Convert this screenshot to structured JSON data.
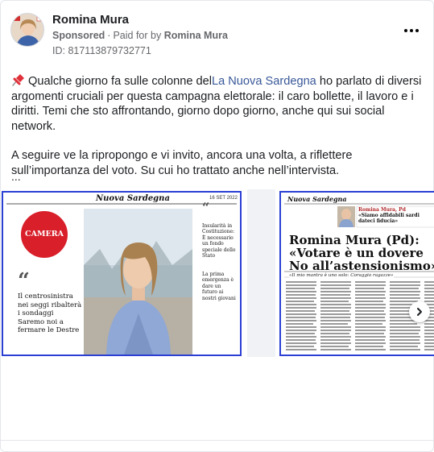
{
  "header": {
    "page_name": "Romina Mura",
    "sponsored": "Sponsored",
    "paid_for_by": "Paid for by",
    "advertiser": "Romina Mura",
    "ad_id": "ID: 817113879732771"
  },
  "post": {
    "para1_pre": "Qualche giorno fa sulle colonne del",
    "para1_link": "La Nuova Sardegna",
    "para1_post": " ho parlato di diversi argomenti cruciali per questa campagna elettorale: il caro bollette, il lavoro e i diritti. Temi che sto affrontando, giorno dopo giorno, anche qui sui social network.",
    "para2": "A seguire ve la ripropongo e vi invito, ancora una volta, a riflettere sull’importanza del voto. Su cui ho trattato anche nell’intervista.",
    "ellipsis": "..."
  },
  "image1": {
    "masthead": "Nuova Sardegna",
    "date": "16 SET 2022",
    "badge": "CAMERA",
    "quote": "Il centrosinistra nei seggi ribalterà i sondaggi Saremo noi a fermare le Destre",
    "side_text1": "Insularità in Costituzione: È necessario un fondo speciale dello Stato",
    "side_text2": "La prima emergenza è dare un futuro ai nostri giovani"
  },
  "image2": {
    "masthead": "Nuova Sardegna",
    "box_title": "Romina Mura, Pd",
    "box_quote": "«Siamo affidabili sardi dateci fiducia»",
    "headline1": "Romina Mura (Pd):",
    "headline2": "«Votare è un dovere",
    "headline3": "No all’astensionismo»",
    "subhead": "«Il mio mantra è uno solo: Coraggio ragazze»"
  },
  "colors": {
    "link": "#385898",
    "frame_border": "#2b3fd4",
    "badge_red": "#d81f2a"
  },
  "icons": [
    "pin-icon",
    "more-icon",
    "chevron-right-icon"
  ]
}
